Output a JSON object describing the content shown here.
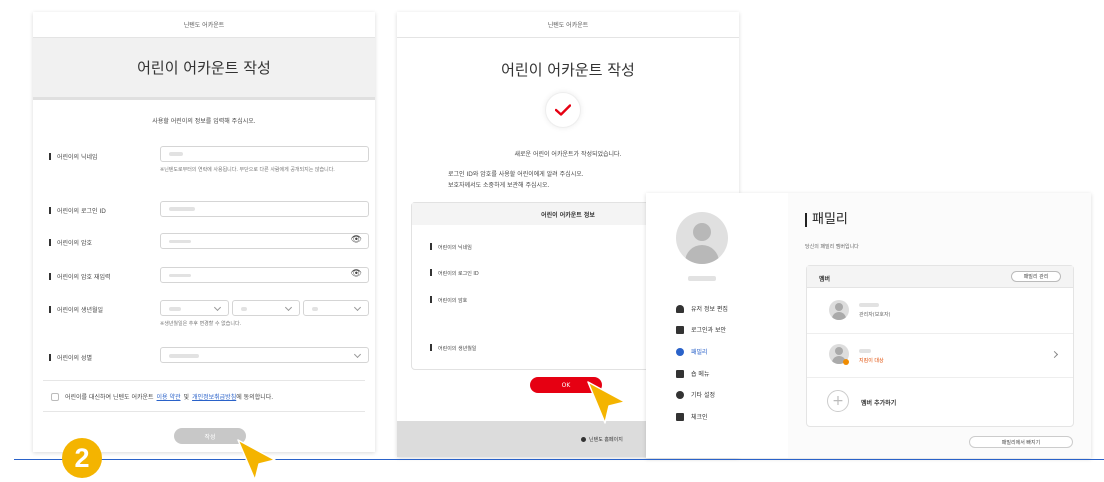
{
  "panel1": {
    "topbar": "닌텐도 어카운트",
    "title": "어린이 어카운트 작성",
    "intro": "사용할 어린이의 정보를 입력해 주십시오.",
    "fields": [
      {
        "label": "어린이의 닉네임"
      },
      {
        "label": "어린이의 로그인 ID"
      },
      {
        "label": "어린이의 암호"
      },
      {
        "label": "어린이의 암호 재입력"
      },
      {
        "label": "어린이의 생년월일"
      },
      {
        "label": "어린이의 성별"
      }
    ],
    "nickname_note": "※닌텐도로부터의 연락에 사용됩니다. 무단으로 다른 사람에게 공개되지는 않습니다.",
    "birthday_note": "※생년월일은 추후 변경할 수 없습니다.",
    "agree_prefix": "어린이를 대신하여 닌텐도 어카운트",
    "agree_terms": "이용 약관",
    "agree_mid": "및",
    "agree_privacy": "개인정보취급방침",
    "agree_suffix": "에 동의합니다.",
    "submit": "작성"
  },
  "panel2": {
    "topbar": "닌텐도 어카운트",
    "title": "어린이 어카운트 작성",
    "done": "새로운 어린이 어카운트가 작성되었습니다.",
    "msg1": "로그인 ID와 암호를 사용할 어린이에게 알려 주십시오.",
    "msg2": "보호자께서도 소중하게 보관해 주십시오.",
    "info_title": "어린이 어카운트 정보",
    "info_rows": [
      "어린이의 닉네임",
      "어린이의 로그인 ID",
      "어린이의 암호",
      "어린이의 생년월일"
    ],
    "ok": "OK",
    "footer": "닌텐도 홈페이지"
  },
  "panel3": {
    "title": "패밀리",
    "subtitle": "당신의 패밀리 멤버입니다",
    "menu": [
      "유저 정보 편집",
      "로그인과 보안",
      "패밀리",
      "숍 메뉴",
      "기타 설정",
      "체크인"
    ],
    "members_header": "멤버",
    "manage": "패밀리 관리",
    "member1_role": "관리자(보호자)",
    "member2_role": "지킴이 대상",
    "add_member": "멤버 추가하기",
    "leave": "패밀리에서 빠지기"
  },
  "step_number": "2",
  "colors": {
    "accent": "#e60012",
    "badge": "#f4b400"
  }
}
